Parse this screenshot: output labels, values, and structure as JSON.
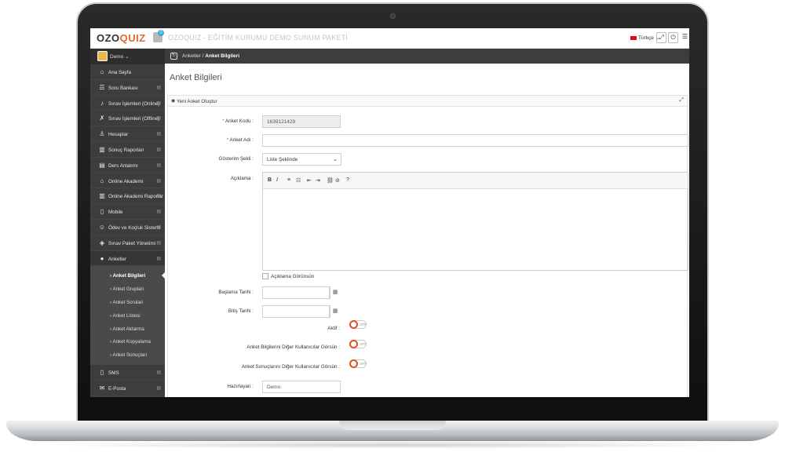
{
  "topbar": {
    "logo_prefix": "OZO",
    "logo_suffix": "QUIZ",
    "cart_badge": "0",
    "app_title": "OZOQUIZ - EĞİTİM KURUMU DEMO SUNUM PAKETİ",
    "language": "Türkçe",
    "icons": [
      "fullscreen-icon",
      "power-icon",
      "menu-icon"
    ]
  },
  "sidebar": {
    "user": "Demo",
    "items": [
      {
        "label": "Ana Sayfa",
        "icon": "home-icon"
      },
      {
        "label": "Soru Bankası",
        "icon": "list-icon"
      },
      {
        "label": "Sınav İşlemleri (Online)",
        "icon": "bell-icon"
      },
      {
        "label": "Sınav İşlemleri (Offline)",
        "icon": "bell-off-icon"
      },
      {
        "label": "Hesaplar",
        "icon": "user-icon"
      },
      {
        "label": "Sonuç Raporları",
        "icon": "bar-chart-icon"
      },
      {
        "label": "Ders Anlatımı",
        "icon": "document-icon"
      },
      {
        "label": "Online Akademi",
        "icon": "building-icon"
      },
      {
        "label": "Online Akademi Raporlar",
        "icon": "bar-chart-icon"
      },
      {
        "label": "Mobile",
        "icon": "mobile-icon"
      },
      {
        "label": "Ödev ve Koçluk Sistemi",
        "icon": "smile-icon"
      },
      {
        "label": "Sınav Paket Yönetimi",
        "icon": "box-icon"
      },
      {
        "label": "Anketler",
        "icon": "circle-icon"
      }
    ],
    "submenu": [
      {
        "label": "Anket Bilgileri",
        "active": true
      },
      {
        "label": "Anket Grupları",
        "active": false
      },
      {
        "label": "Anket Soruları",
        "active": false
      },
      {
        "label": "Anket Listesi",
        "active": false
      },
      {
        "label": "Anket Aktarma",
        "active": false
      },
      {
        "label": "Anket Kopyalama",
        "active": false
      },
      {
        "label": "Anket Sonuçları",
        "active": false
      }
    ],
    "bottom_items": [
      {
        "label": "SMS",
        "icon": "mobile-icon"
      },
      {
        "label": "E-Posta",
        "icon": "mail-icon"
      }
    ]
  },
  "breadcrumb": {
    "parent": "Anketler",
    "separator": "/",
    "current": "Anket Bilgileri"
  },
  "page_title": "Anket Bilgileri",
  "panel_title": "Yeni Anket Oluştur",
  "form": {
    "code_label": "Anket Kodu :",
    "code_value": "1639121429",
    "name_label": "Anket Adı :",
    "name_value": "",
    "display_label": "Gösterim Şekli :",
    "display_value": "Liste Şeklinde",
    "desc_label": "Açıklama :",
    "desc_show_label": "Açıklama Görünsün",
    "start_label": "Başlama Tarihi :",
    "end_label": "Bitiş Tarihi :",
    "active_label": "Aktif :",
    "info_visible_label": "Anket Bilgilerini Diğer Kullanıcılar Görsün :",
    "results_visible_label": "Anket Sonuçlarını Diğer Kullanıcılar Görsün :",
    "preparer_label": "Hazırlayan :",
    "preparer_value": "Demo",
    "toggle_off": "OFF",
    "required_mark": "*"
  },
  "editor_tools": [
    "B",
    "I",
    "≡",
    "☷",
    "⇤",
    "⇥",
    "⛓",
    "⊘",
    "?"
  ],
  "colors": {
    "sidebar": "#3d3d3d",
    "accent": "#e0531f",
    "required": "#d9534f"
  }
}
